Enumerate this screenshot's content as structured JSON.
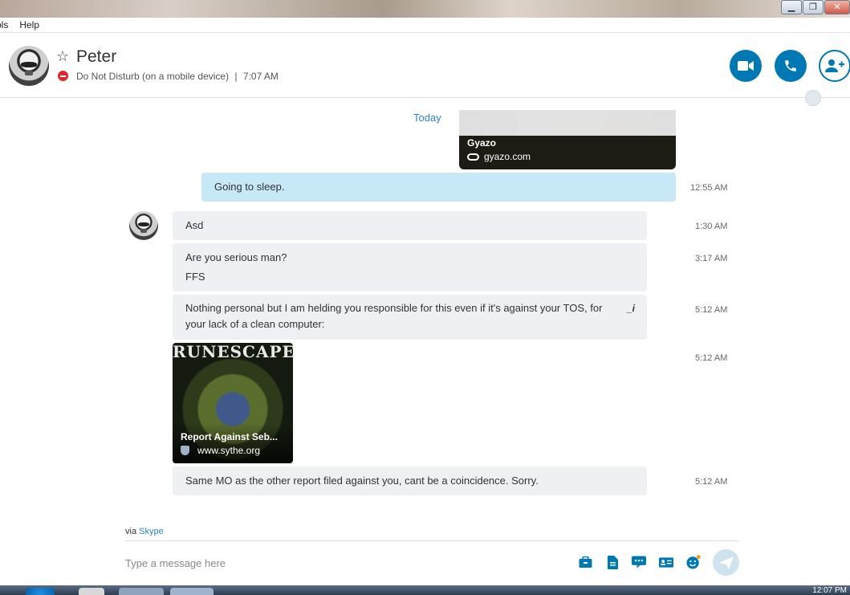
{
  "window": {
    "minimize_glyph": "▁",
    "restore_glyph": "❐",
    "close_glyph": "✕"
  },
  "menu": [
    "ols",
    "Help"
  ],
  "header": {
    "contact_name": "Peter",
    "status": "Do Not Disturb (on a mobile device)",
    "separator": "|",
    "local_time": "7:07 AM",
    "star_glyph": "☆"
  },
  "conversation": {
    "day_label": "Today",
    "link_preview": {
      "title": "Gyazo",
      "url": "gyazo.com"
    },
    "messages": [
      {
        "direction": "out",
        "text": "Going to sleep.",
        "time": "12:55 AM"
      },
      {
        "direction": "in",
        "text": "Asd",
        "time": "1:30 AM"
      },
      {
        "direction": "in",
        "lines": [
          "Are you serious man?",
          "FFS"
        ],
        "time": "3:17 AM"
      },
      {
        "direction": "in",
        "lines": [
          "Nothing personal but I am helding you responsible for this even if it's against your TOS, for",
          "your lack of a clean computer:"
        ],
        "time": "5:12 AM",
        "edited_glyph": "_i"
      },
      {
        "direction": "in",
        "type": "image-link",
        "banner": "RUNESCAPE",
        "title": "Report Against Seb...",
        "url": "www.sythe.org",
        "time": "5:12 AM"
      },
      {
        "direction": "in",
        "text": "Same MO as the other report filed against you, cant be a coincidence. Sorry.",
        "time": "5:12 AM"
      }
    ]
  },
  "footer": {
    "via_prefix": "via",
    "via_link": "Skype",
    "input_placeholder": "Type a message here"
  },
  "taskbar": {
    "clock": "12:07 PM"
  },
  "colors": {
    "accent": "#0078b4",
    "outgoing_bubble": "#c7e8f7",
    "incoming_bubble": "#eef0f4",
    "dnd": "#e0282b"
  }
}
